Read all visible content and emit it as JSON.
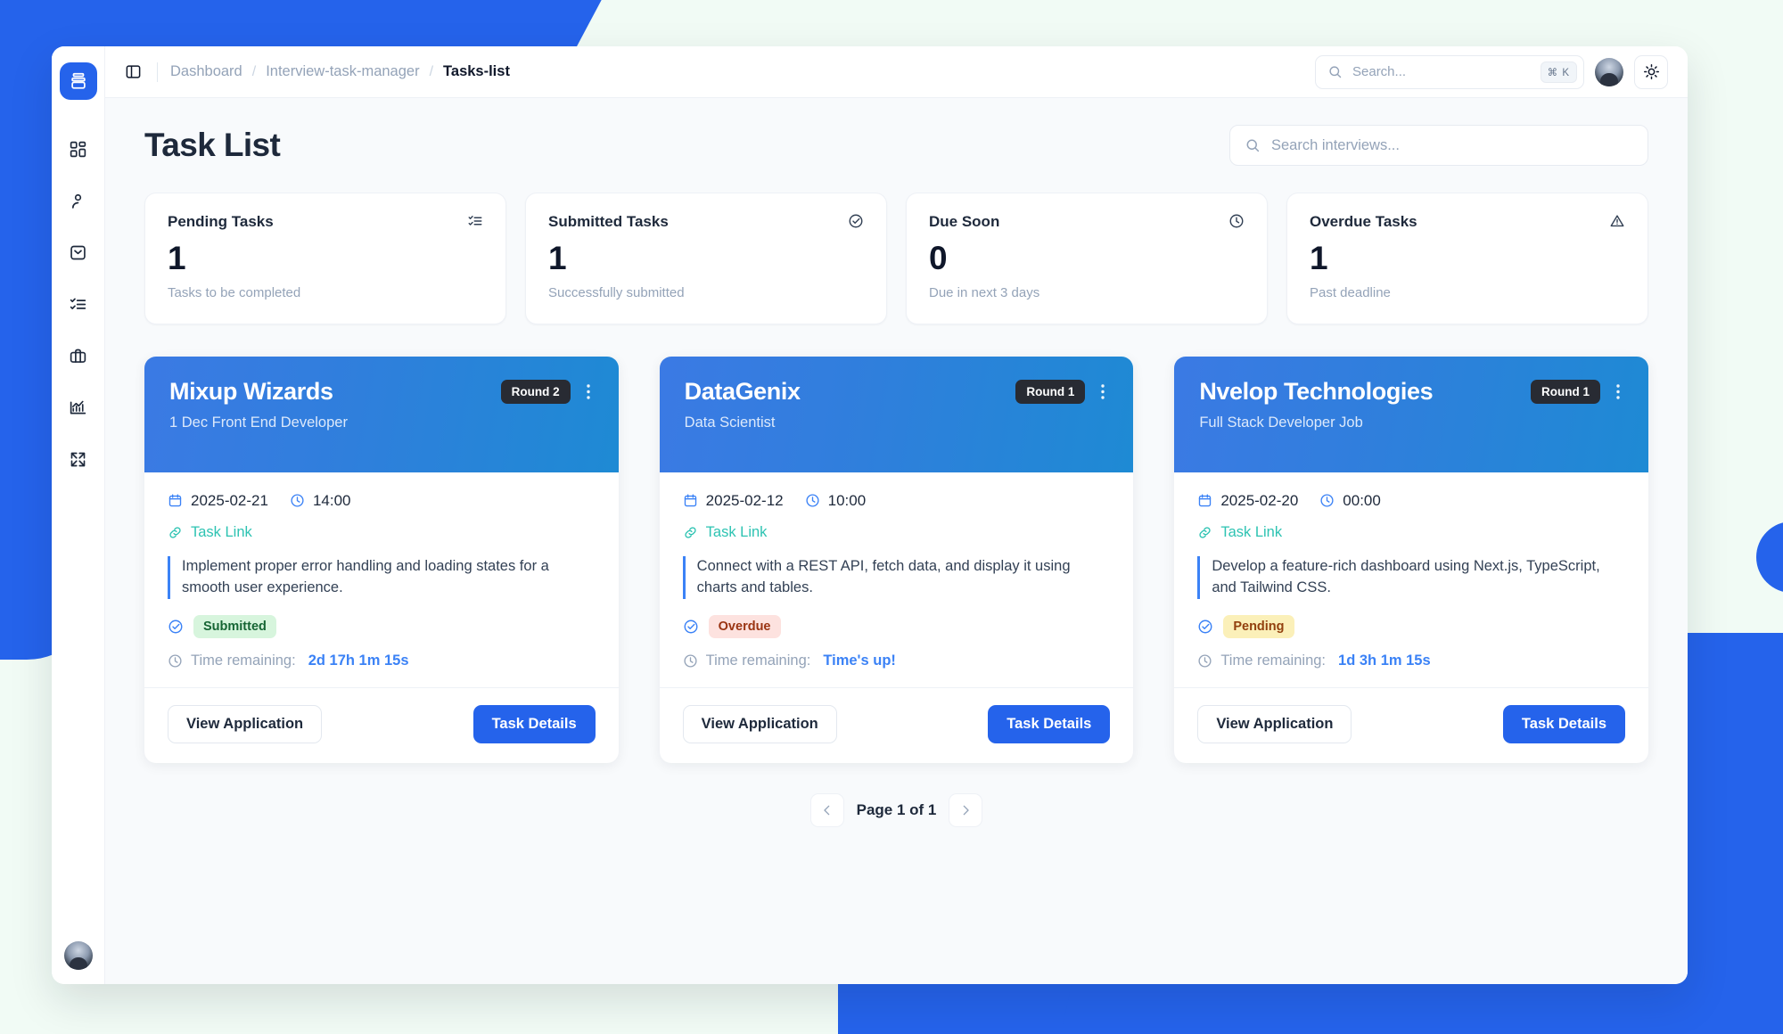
{
  "window": {
    "topbar": {
      "panel_toggle_icon": "panel-left-icon",
      "breadcrumb": [
        "Dashboard",
        "Interview-task-manager",
        "Tasks-list"
      ],
      "breadcrumb_separator": "/",
      "search_placeholder": "Search...",
      "search_value": "",
      "search_shortcut": "⌘ K",
      "search_icon": "search-icon",
      "avatar_icon": "user-avatar",
      "theme_toggle_icon": "sun-icon"
    },
    "sidebar": {
      "logo_icon": "layers-logo-icon",
      "items": [
        {
          "icon": "dashboard-grid-icon",
          "name": "dashboard"
        },
        {
          "icon": "user-icon",
          "name": "profile"
        },
        {
          "icon": "inbox-archive-icon",
          "name": "inbox"
        },
        {
          "icon": "task-list-icon",
          "name": "tasks"
        },
        {
          "icon": "briefcase-icon",
          "name": "jobs"
        },
        {
          "icon": "chart-bar-icon",
          "name": "analytics"
        },
        {
          "icon": "collapse-arrows-icon",
          "name": "collapse"
        }
      ],
      "bottom_avatar_icon": "user-avatar"
    }
  },
  "page": {
    "title": "Task List",
    "search": {
      "placeholder": "Search interviews...",
      "value": "",
      "icon": "search-icon"
    },
    "stats": [
      {
        "label": "Pending Tasks",
        "value": "1",
        "sub": "Tasks to be completed",
        "icon": "list-check-icon"
      },
      {
        "label": "Submitted Tasks",
        "value": "1",
        "sub": "Successfully submitted",
        "icon": "check-circle-icon"
      },
      {
        "label": "Due Soon",
        "value": "0",
        "sub": "Due in next 3 days",
        "icon": "clock-icon"
      },
      {
        "label": "Overdue Tasks",
        "value": "1",
        "sub": "Past deadline",
        "icon": "alert-triangle-icon"
      }
    ],
    "cards": [
      {
        "company": "Mixup Wizards",
        "round": "Round 2",
        "role": "1 Dec Front End Developer",
        "date": "2025-02-21",
        "time": "14:00",
        "link_label": "Task Link",
        "description": "Implement proper error handling and loading states for a smooth user experience.",
        "status": "Submitted",
        "status_kind": "submitted",
        "time_label": "Time remaining:",
        "time_value": "2d 17h 1m 15s",
        "btn_secondary": "View Application",
        "btn_primary": "Task Details",
        "menu_icon": "kebab-menu-icon"
      },
      {
        "company": "DataGenix",
        "round": "Round 1",
        "role": "Data Scientist",
        "date": "2025-02-12",
        "time": "10:00",
        "link_label": "Task Link",
        "description": "Connect with a REST API, fetch data, and display it using charts and tables.",
        "status": "Overdue",
        "status_kind": "overdue",
        "time_label": "Time remaining:",
        "time_value": "Time's up!",
        "btn_secondary": "View Application",
        "btn_primary": "Task Details",
        "menu_icon": "kebab-menu-icon"
      },
      {
        "company": "Nvelop Technologies",
        "round": "Round 1",
        "role": "Full Stack Developer Job",
        "date": "2025-02-20",
        "time": "00:00",
        "link_label": "Task Link",
        "description": "Develop a feature-rich dashboard using Next.js, TypeScript, and Tailwind CSS.",
        "status": "Pending",
        "status_kind": "pending",
        "time_label": "Time remaining:",
        "time_value": "1d 3h 1m 15s",
        "btn_secondary": "View Application",
        "btn_primary": "Task Details",
        "menu_icon": "kebab-menu-icon"
      }
    ],
    "pagination": {
      "prev_icon": "chevron-left-icon",
      "next_icon": "chevron-right-icon",
      "label": "Page 1 of 1"
    }
  },
  "colors": {
    "accent": "#2563eb",
    "card_header_from": "#3b7ae4",
    "card_header_to": "#1e8ad4",
    "link_teal": "#2dc3b2",
    "page_bg": "#f1fbf5",
    "content_bg": "#f8fafc",
    "badge_dark": "#282b33",
    "submitted_bg": "#d7f5dd",
    "overdue_bg": "#fde2df",
    "pending_bg": "#fbf0b9"
  }
}
